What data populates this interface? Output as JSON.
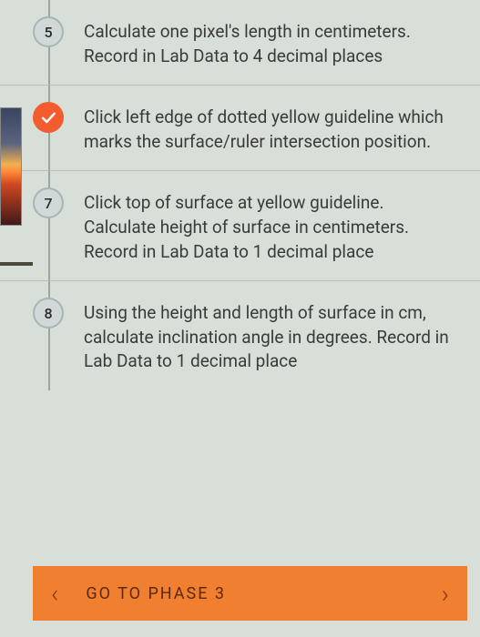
{
  "steps": [
    {
      "number": "5",
      "type": "number",
      "text": "Calculate one pixel's length in centimeters. Record in Lab Data to 4 decimal places"
    },
    {
      "number": "",
      "type": "check",
      "text": "Click left edge of dotted yellow guideline which marks the surface/ruler intersection position."
    },
    {
      "number": "7",
      "type": "number",
      "text": "Click top of surface at yellow guideline. Calculate height of surface in centimeters. Record in Lab Data to 1 decimal place"
    },
    {
      "number": "8",
      "type": "number",
      "text": "Using the height and length of surface in cm, calculate inclination angle in degrees. Record in Lab Data to 1 decimal place"
    }
  ],
  "button": {
    "label": "GO TO PHASE 3"
  }
}
